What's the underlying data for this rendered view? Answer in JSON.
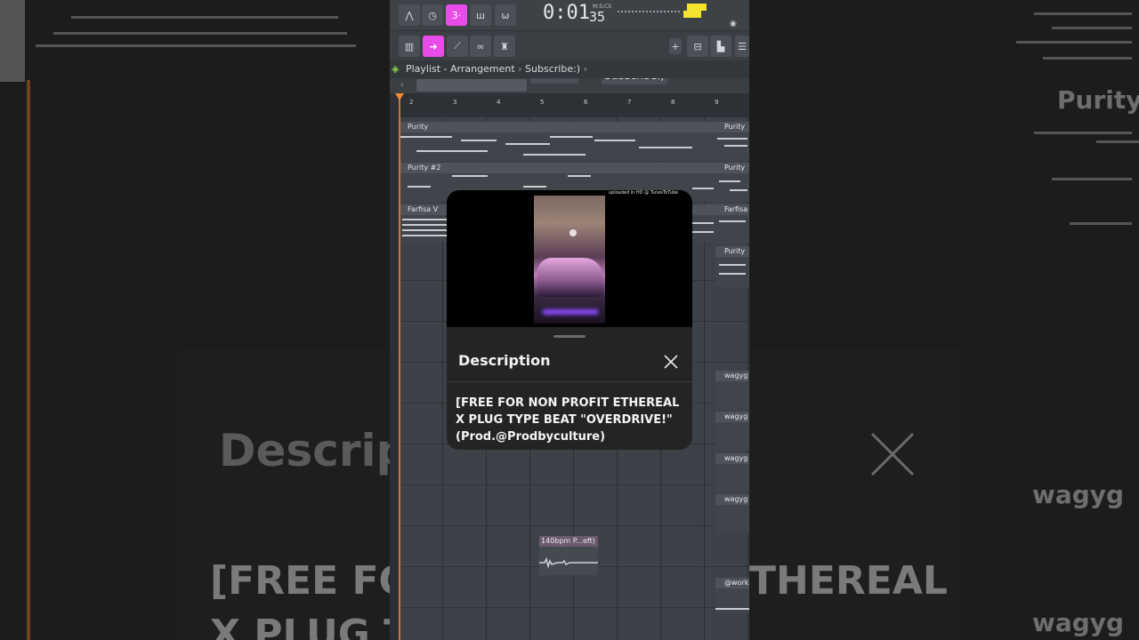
{
  "toolbar": {
    "time_main": "0:01",
    "time_label": "M:S:CS",
    "time_ms": "35",
    "snap_dropdown": "Line",
    "pattern_name": "Subscribe:)",
    "plus_label": "+"
  },
  "breadcrumb": {
    "path": "Playlist - Arrangement",
    "sep": "›",
    "current": "Subscribe:)"
  },
  "ruler": {
    "ticks": [
      "2",
      "3",
      "4",
      "5",
      "6",
      "7",
      "8",
      "9"
    ]
  },
  "tracks": {
    "purity": "Purity",
    "purity2": "Purity #2",
    "farfisa": "Farfisa V",
    "purity_right": "Purity",
    "purity2_right": "Purity",
    "farfisa_right": "Farfisa",
    "purity3_right": "Purity",
    "wagy1": "wagyg",
    "wagy2": "wagyg",
    "wagy3": "wagyg",
    "wagy4": "wagyg",
    "work": "@work",
    "audio_clip": "140bpm P...eft)"
  },
  "player": {
    "watermark": "uploaded in HD @ TunesToTube"
  },
  "description": {
    "title": "Description",
    "text": "[FREE FOR NON PROFIT ETHEREAL X PLUG TYPE BEAT \"OVERDRIVE!\" (Prod.@Prodbyculture)"
  },
  "background": {
    "descrip": "Descrip",
    "free_line": "[FREE FO",
    "x_plug": "X PLUG T",
    "ethereal": "THEREAL",
    "purity_big": "Purity",
    "wagy_big": "wagyg",
    "wagy_big2": "wagyg"
  },
  "colors": {
    "accent": "#e84ce8",
    "playhead": "#f08a32",
    "level": "#f5e22c"
  }
}
